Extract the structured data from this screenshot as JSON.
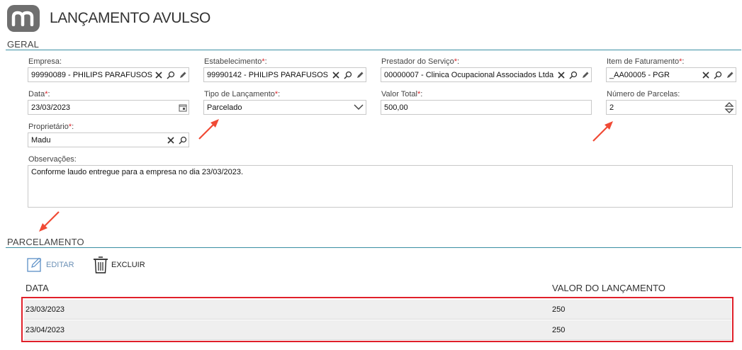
{
  "header": {
    "title": "LANÇAMENTO AVULSO"
  },
  "sections": {
    "geral": "GERAL",
    "parcelamento": "PARCELAMENTO"
  },
  "required_marker": "*",
  "form": {
    "empresa": {
      "label": "Empresa:",
      "value": "99990089 - PHILIPS PARAFUSOS"
    },
    "estabelecimento": {
      "label": "Estabelecimento",
      "suffix": ":",
      "value": "99990142 - PHILIPS PARAFUSOS"
    },
    "prestador": {
      "label": "Prestador do Serviço",
      "suffix": ":",
      "value": "00000007 - Clinica Ocupacional Associados Ltda"
    },
    "item_faturamento": {
      "label": "Item de Faturamento",
      "suffix": ":",
      "value": "_AA00005 - PGR"
    },
    "data": {
      "label": "Data",
      "suffix": ":",
      "value": "23/03/2023"
    },
    "tipo_lancamento": {
      "label": "Tipo de Lançamento",
      "suffix": ":",
      "value": "Parcelado"
    },
    "valor_total": {
      "label": "Valor Total",
      "suffix": ":",
      "value": "500,00"
    },
    "numero_parcelas": {
      "label": "Número de Parcelas:",
      "value": "2"
    },
    "proprietario": {
      "label": "Proprietário",
      "suffix": ":",
      "value": "Madu"
    },
    "observacoes": {
      "label": "Observações:",
      "value": "Conforme laudo entregue para a empresa no dia 23/03/2023."
    }
  },
  "toolbar": {
    "edit_label": "EDITAR",
    "delete_label": "EXCLUIR"
  },
  "table": {
    "columns": [
      "DATA",
      "VALOR DO LANÇAMENTO"
    ],
    "rows": [
      {
        "data": "23/03/2023",
        "valor": "250"
      },
      {
        "data": "23/04/2023",
        "valor": "250"
      }
    ]
  },
  "colors": {
    "accent_line": "#3a8fa3",
    "required": "#d9252a",
    "highlight_border": "#e0202a",
    "arrow": "#f04a35"
  }
}
